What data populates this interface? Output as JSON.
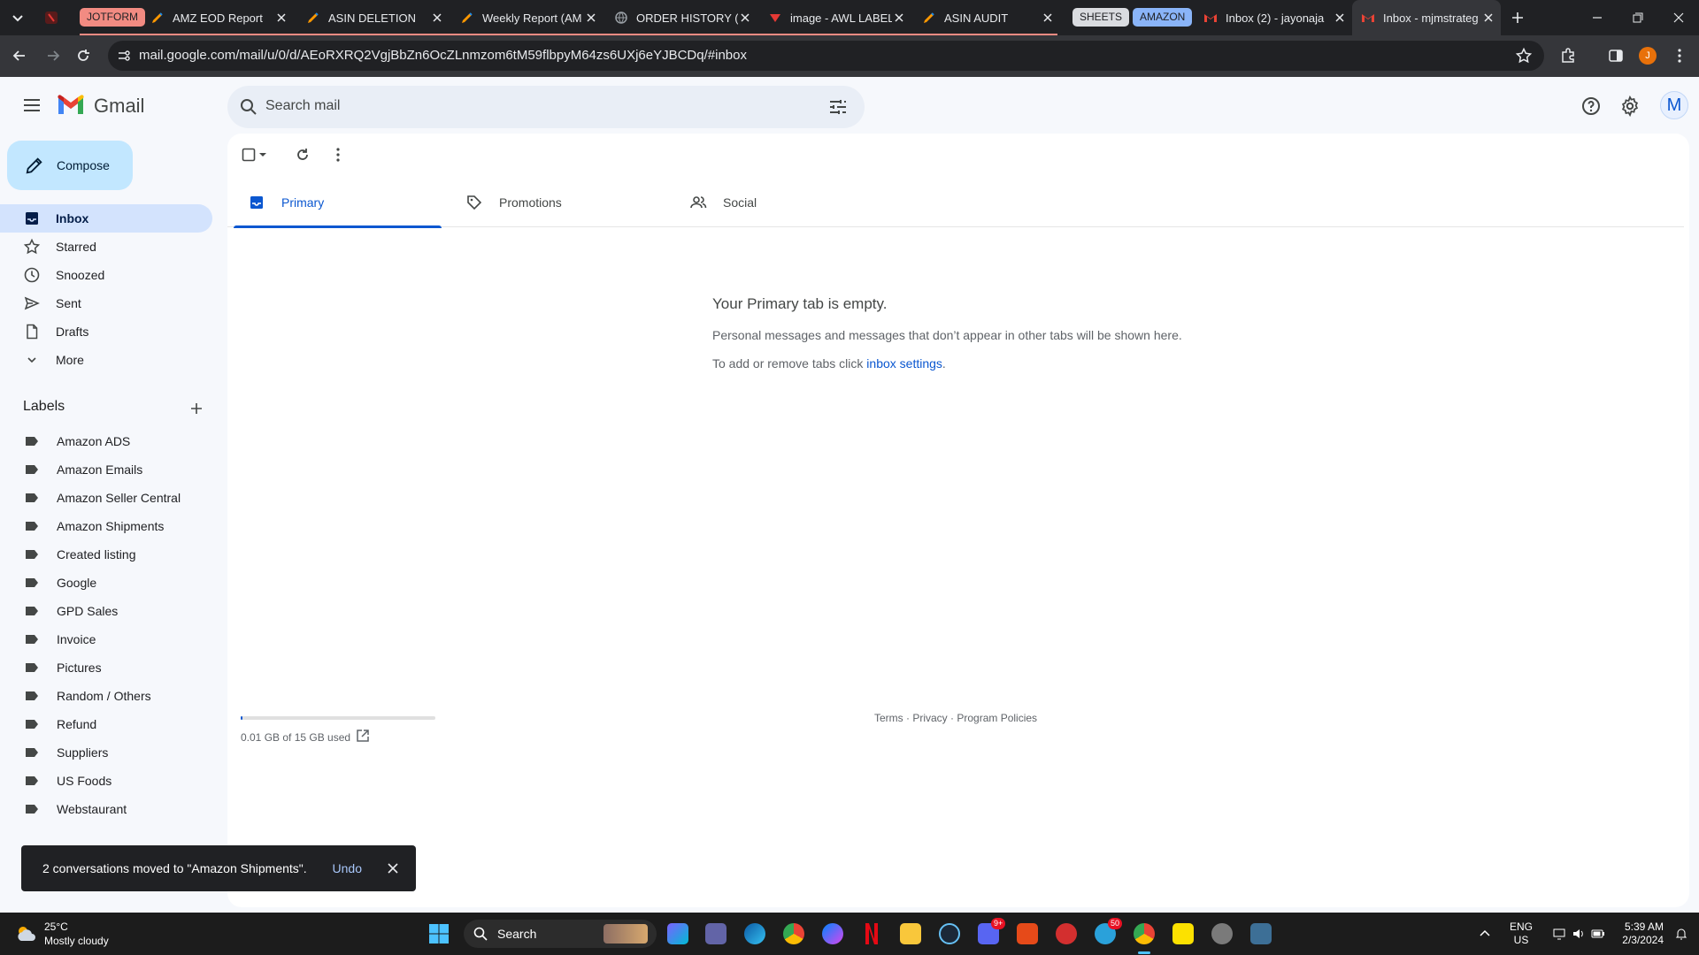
{
  "browser": {
    "tabs": [
      {
        "title": "AMZ EOD Report",
        "icon": "pen-icon"
      },
      {
        "title": "ASIN DELETION",
        "icon": "pen-icon"
      },
      {
        "title": "Weekly Report (AM",
        "icon": "pen-icon"
      },
      {
        "title": "ORDER HISTORY (C",
        "icon": "globe-icon"
      },
      {
        "title": "image - AWL LABEL",
        "icon": "doc-icon"
      },
      {
        "title": "ASIN AUDIT",
        "icon": "pen-icon"
      },
      {
        "title": "Inbox (2) - jayonaja",
        "icon": "gmail-icon"
      },
      {
        "title": "Inbox - mjmstrateg",
        "icon": "gmail-icon"
      }
    ],
    "tab_groups": {
      "jotform": "JOTFORM",
      "sheets": "SHEETS",
      "amazon": "AMAZON"
    },
    "group_colors": {
      "jotform": "#f28b82",
      "sheets": "#dadce0",
      "amazon": "#8ab4f8"
    },
    "url": "mail.google.com/mail/u/0/d/AEoRXRQ2VgjBbZn6OcZLnmzom6tM59flbpyM64zs6UXj6eYJBCDq/#inbox",
    "profile_initial": "J"
  },
  "gmail": {
    "product_name": "Gmail",
    "search_placeholder": "Search mail",
    "avatar_initial": "M",
    "compose_label": "Compose",
    "nav": [
      {
        "label": "Inbox",
        "icon": "inbox-icon",
        "active": true
      },
      {
        "label": "Starred",
        "icon": "star-icon"
      },
      {
        "label": "Snoozed",
        "icon": "clock-icon"
      },
      {
        "label": "Sent",
        "icon": "send-icon"
      },
      {
        "label": "Drafts",
        "icon": "draft-icon"
      },
      {
        "label": "More",
        "icon": "chevron-down-icon"
      }
    ],
    "labels_heading": "Labels",
    "labels": [
      "Amazon ADS",
      "Amazon Emails",
      "Amazon Seller Central",
      "Amazon Shipments",
      "Created listing",
      "Google",
      "GPD Sales",
      "Invoice",
      "Pictures",
      "Random / Others",
      "Refund",
      "Suppliers",
      "US Foods",
      "Webstaurant"
    ],
    "category_tabs": [
      {
        "label": "Primary",
        "icon": "inbox-icon",
        "active": true
      },
      {
        "label": "Promotions",
        "icon": "tag-icon"
      },
      {
        "label": "Social",
        "icon": "people-icon"
      }
    ],
    "empty_state": {
      "title": "Your Primary tab is empty.",
      "message": "Personal messages and messages that don’t appear in other tabs will be shown here.",
      "settings_prefix": "To add or remove tabs click ",
      "settings_link": "inbox settings",
      "settings_suffix": "."
    },
    "storage": {
      "text": "0.01 GB of 15 GB used",
      "fraction": 0.0007
    },
    "footer": {
      "terms": "Terms",
      "sep": " · ",
      "privacy": "Privacy",
      "policies": "Program Policies"
    },
    "snackbar": {
      "message": "2 conversations moved to \"Amazon Shipments\".",
      "action": "Undo"
    },
    "accent_color": "#0b57d0"
  },
  "taskbar": {
    "weather_temp": "25°C",
    "weather_desc": "Mostly cloudy",
    "search_label": "Search",
    "badges": {
      "discord": "9+",
      "telegram": "50"
    },
    "lang": "ENG",
    "region": "US",
    "time": "5:39 AM",
    "date": "2/3/2024"
  }
}
